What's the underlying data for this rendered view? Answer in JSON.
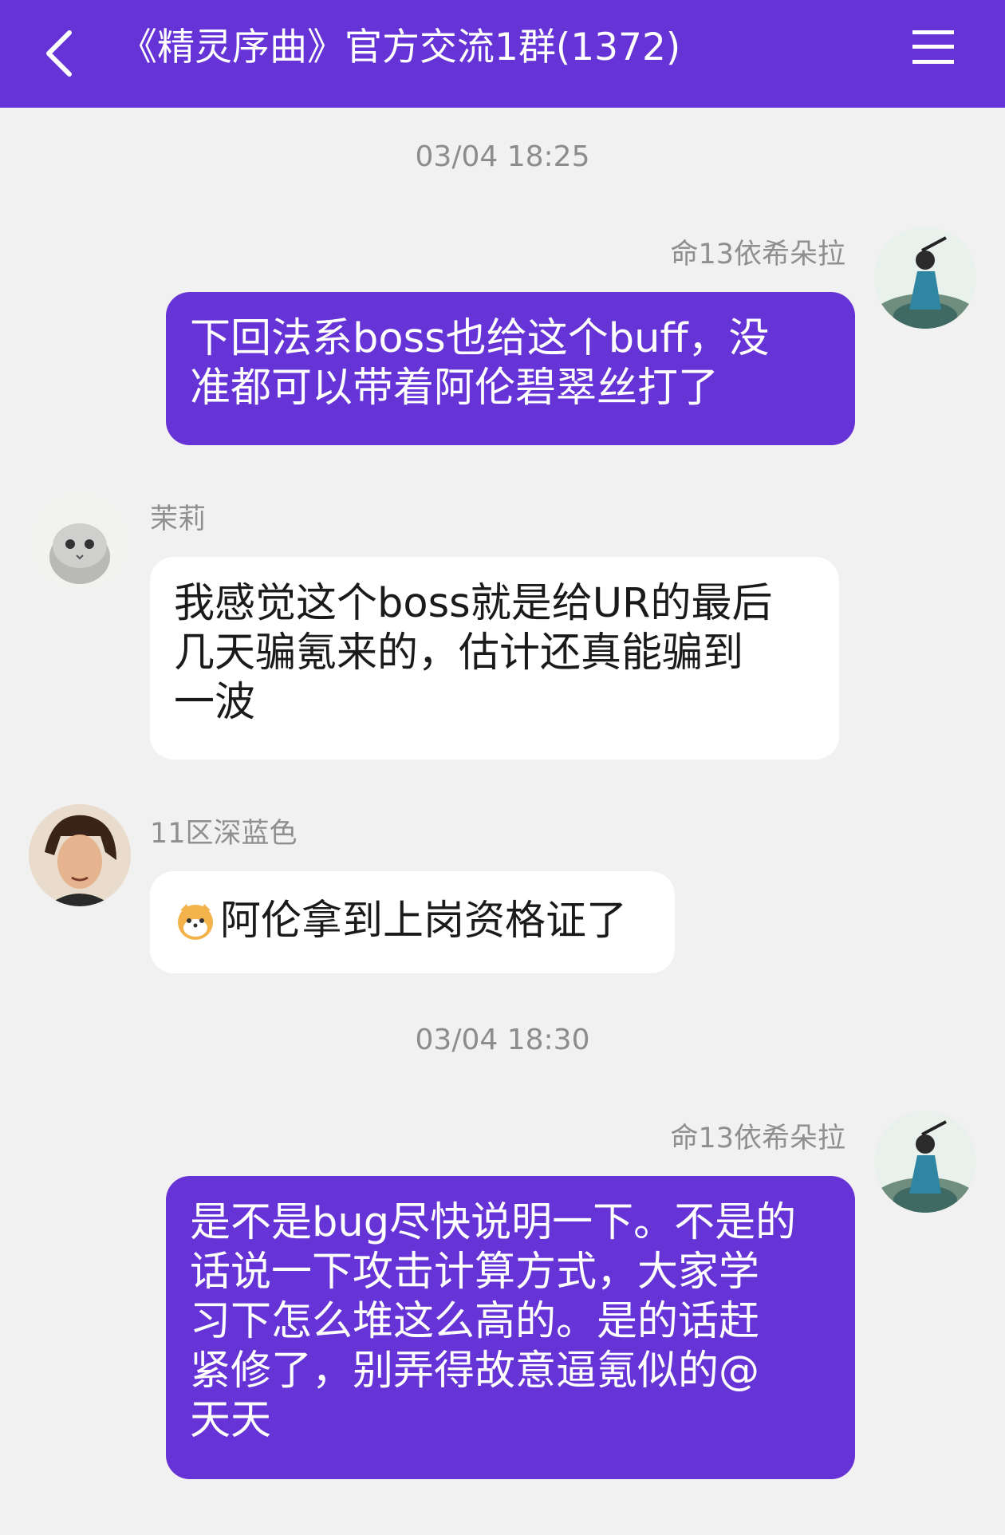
{
  "header": {
    "back_icon": "chevron-left-icon",
    "title": "《精灵序曲》官方交流1群(1372)",
    "menu_icon": "hamburger-menu-icon"
  },
  "messages": [
    {
      "type": "time",
      "text": "03/04 18:25"
    },
    {
      "type": "msg",
      "side": "right",
      "sender": "命13依希朵拉",
      "lines": [
        "下回法系boss也给这个buff，没",
        "准都可以带着阿伦碧翠丝打了"
      ]
    },
    {
      "type": "msg",
      "side": "left",
      "sender": "茉莉",
      "lines": [
        "我感觉这个boss就是给UR的最后",
        "几天骗氪来的，估计还真能骗到",
        "一波"
      ]
    },
    {
      "type": "msg",
      "side": "left",
      "sender": "11区深蓝色",
      "emoji": "shiba-dog-emoji",
      "lines": [
        "阿伦拿到上岗资格证了"
      ]
    },
    {
      "type": "time",
      "text": "03/04 18:30"
    },
    {
      "type": "msg",
      "side": "right",
      "sender": "命13依希朵拉",
      "lines": [
        "是不是bug尽快说明一下。不是的",
        "话说一下攻击计算方式，大家学",
        "习下怎么堆这么高的。是的话赶",
        "紧修了，别弄得故意逼氪似的@",
        "天天"
      ]
    }
  ],
  "colors": {
    "accent": "#6634d6",
    "background": "#f1f1f1",
    "bubble_other": "#ffffff"
  }
}
